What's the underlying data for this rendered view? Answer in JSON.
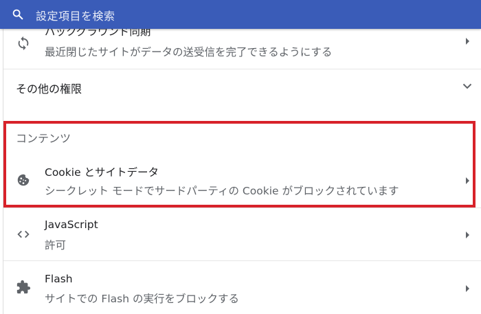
{
  "search": {
    "placeholder": "設定項目を検索"
  },
  "rows": {
    "background_sync": {
      "title": "バックグラウンド同期",
      "subtitle": "最近閉じたサイトがデータの送受信を完了できるようにする"
    },
    "other_permissions": {
      "title": "その他の権限"
    },
    "content_section": {
      "title": "コンテンツ"
    },
    "cookies": {
      "title": "Cookie とサイトデータ",
      "subtitle": "シークレット モードでサードパーティの Cookie がブロックされています"
    },
    "javascript": {
      "title": "JavaScript",
      "subtitle": "許可"
    },
    "flash": {
      "title": "Flash",
      "subtitle": "サイトでの Flash の実行をブロックする"
    }
  },
  "colors": {
    "topbar": "#3a5cb8",
    "highlight": "#d8222a",
    "secondary_text": "#5f6368"
  },
  "icons": {
    "search": "search-icon",
    "sync": "sync-icon",
    "cookie": "cookie-icon",
    "code": "code-icon",
    "puzzle": "puzzle-icon",
    "expand": "chevron-down-icon",
    "arrow": "arrow-right-icon"
  }
}
